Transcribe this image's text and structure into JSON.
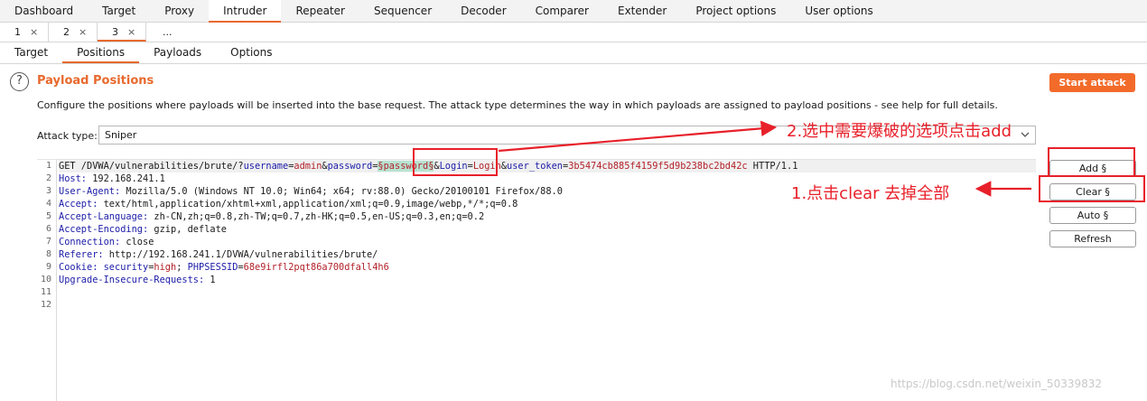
{
  "main_tabs": [
    "Dashboard",
    "Target",
    "Proxy",
    "Intruder",
    "Repeater",
    "Sequencer",
    "Decoder",
    "Comparer",
    "Extender",
    "Project options",
    "User options"
  ],
  "sub_tabs": {
    "tab1": "1",
    "tab2": "2",
    "tab3": "3",
    "more": "...",
    "close_glyph": "×"
  },
  "section_tabs": [
    "Target",
    "Positions",
    "Payloads",
    "Options"
  ],
  "panel": {
    "help_glyph": "?",
    "title": "Payload Positions",
    "start_attack": "Start attack",
    "description": "Configure the positions where payloads will be inserted into the base request. The attack type determines the way in which payloads are assigned to payload positions - see help for full details.",
    "attack_type_label": "Attack type:",
    "attack_type_value": "Sniper"
  },
  "line_numbers": [
    "1",
    "2",
    "3",
    "4",
    "5",
    "6",
    "7",
    "8",
    "9",
    "10",
    "11",
    "12"
  ],
  "request": {
    "l1": {
      "a": "GET /DVWA/vulnerabilities/brute/?",
      "k1": "username",
      "eq1": "=",
      "v1": "admin",
      "amp1": "&",
      "k2": "password",
      "eq2": "=",
      "v2": "§password§",
      "amp2": "&",
      "k3": "Login",
      "eq3": "=",
      "v3": "Login",
      "amp3": "&",
      "k4": "user_token",
      "eq4": "=",
      "v4": "3b5474cb885f4159f5d9b238bc2bd42c",
      "tail": " HTTP/1.1"
    },
    "l2": {
      "k": "Host:",
      "v": " 192.168.241.1"
    },
    "l3": {
      "k": "User-Agent:",
      "v": " Mozilla/5.0 (Windows NT 10.0; Win64; x64; rv:88.0) Gecko/20100101 Firefox/88.0"
    },
    "l4": {
      "k": "Accept:",
      "v": " text/html,application/xhtml+xml,application/xml;q=0.9,image/webp,*/*;q=0.8"
    },
    "l5": {
      "k": "Accept-Language:",
      "v": " zh-CN,zh;q=0.8,zh-TW;q=0.7,zh-HK;q=0.5,en-US;q=0.3,en;q=0.2"
    },
    "l6": {
      "k": "Accept-Encoding:",
      "v": " gzip, deflate"
    },
    "l7": {
      "k": "Connection:",
      "v": " close"
    },
    "l8": {
      "k": "Referer:",
      "v": " http://192.168.241.1/DVWA/vulnerabilities/brute/"
    },
    "l9": {
      "k": "Cookie:",
      "k1": " security",
      "eq1": "=",
      "v1": "high",
      "sep": "; ",
      "k2": "PHPSESSID",
      "eq2": "=",
      "v2": "68e9irfl2pqt86a700dfall4h6"
    },
    "l10": {
      "k": "Upgrade-Insecure-Requests:",
      "v": " 1"
    }
  },
  "side_buttons": {
    "add": "Add §",
    "clear": "Clear §",
    "auto": "Auto §",
    "refresh": "Refresh"
  },
  "annotations": {
    "step2": "2.选中需要爆破的选项点击add",
    "step1": "1.点击clear 去掉全部",
    "color": "#e8202a"
  },
  "watermark": "https://blog.csdn.net/weixin_50339832",
  "colors": {
    "accent": "#e8692d",
    "start_button": "#f26b2a",
    "param_name": "#1c1ca8",
    "param_value": "#b3222a",
    "position_marker_bg": "#b7e3d1"
  }
}
